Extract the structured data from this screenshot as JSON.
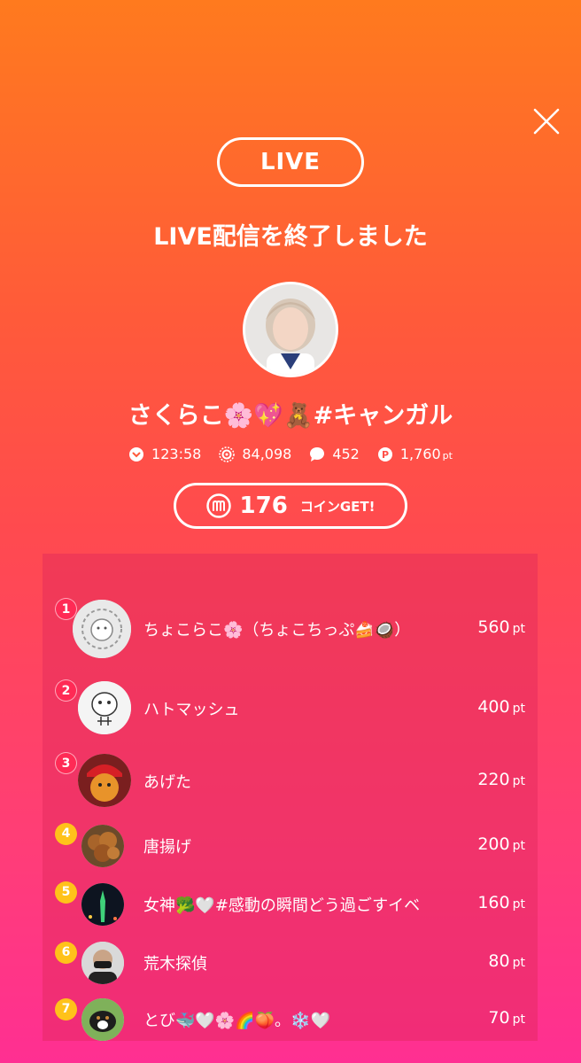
{
  "header": {
    "close_icon": "close-icon",
    "live_label": "LIVE",
    "end_message": "LIVE配信を終了しました"
  },
  "host": {
    "name": "さくらこ🌸💖🧸#キャンガル"
  },
  "stats": {
    "duration": "123:58",
    "viewers": "84,098",
    "comments": "452",
    "points": "1,760",
    "points_unit": "pt"
  },
  "coin": {
    "value": "176",
    "label": "コインGET!"
  },
  "ranking": [
    {
      "rank": "1",
      "name": "ちょこらこ🌸（ちょこちっぷ🍰🥥）",
      "points": "560",
      "unit": "pt"
    },
    {
      "rank": "2",
      "name": "ハトマッシュ",
      "points": "400",
      "unit": "pt"
    },
    {
      "rank": "3",
      "name": "あげた",
      "points": "220",
      "unit": "pt"
    },
    {
      "rank": "4",
      "name": "唐揚げ",
      "points": "200",
      "unit": "pt"
    },
    {
      "rank": "5",
      "name": "女神🥦🤍#感動の瞬間どう過ごすイベ",
      "points": "160",
      "unit": "pt"
    },
    {
      "rank": "6",
      "name": "荒木探偵",
      "points": "80",
      "unit": "pt"
    },
    {
      "rank": "7",
      "name": "とび🐳🤍🌸🌈🍑。❄️🤍",
      "points": "70",
      "unit": "pt"
    }
  ],
  "colors": {
    "top_badge": "#ff2a55",
    "other_badge": "#ffc21a"
  }
}
